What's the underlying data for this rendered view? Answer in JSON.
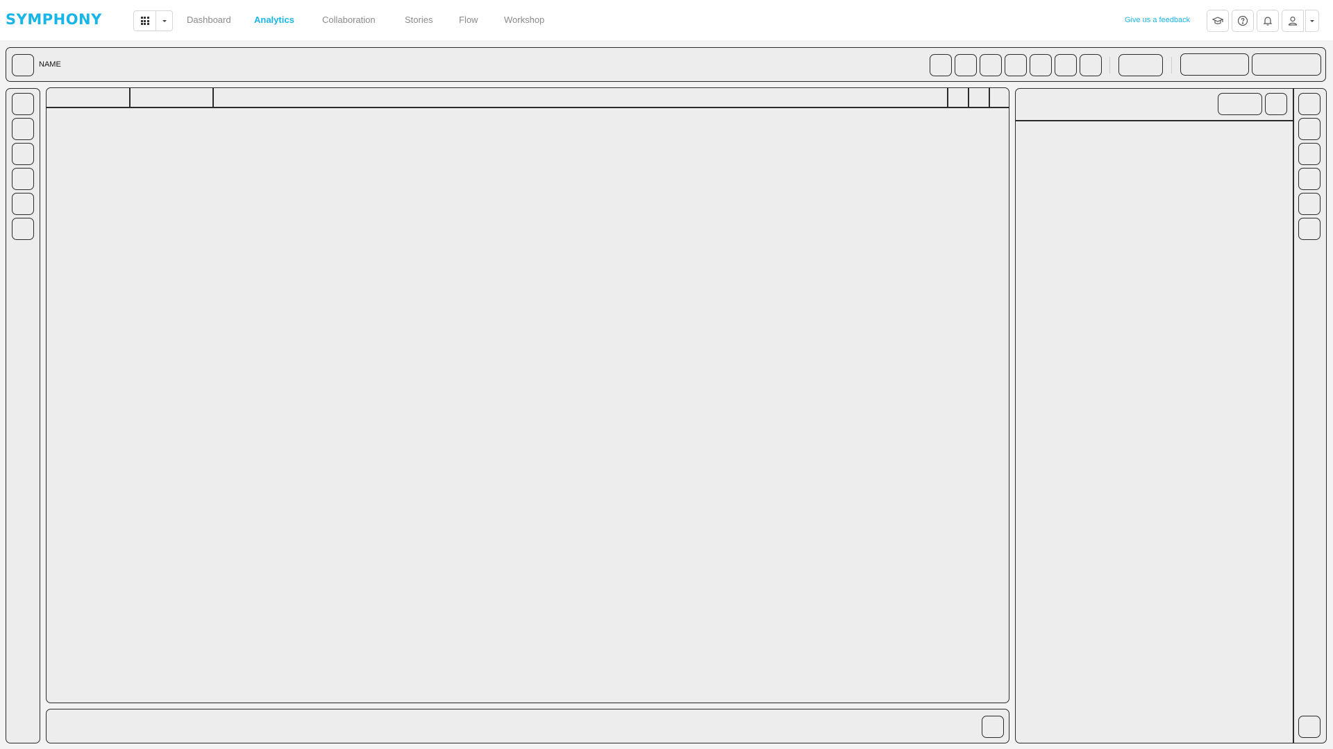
{
  "app": {
    "logo_text": "SYMPHONY",
    "accent_color": "#18b5e8"
  },
  "nav": {
    "items": [
      {
        "label": "Dashboard",
        "active": false
      },
      {
        "label": "Analytics",
        "active": true
      },
      {
        "label": "Collaboration",
        "active": false
      },
      {
        "label": "Stories",
        "active": false
      },
      {
        "label": "Flow",
        "active": false
      },
      {
        "label": "Workshop",
        "active": false
      }
    ],
    "apps_menu_icon": "apps-grid-icon"
  },
  "header_actions": {
    "feedback_label": "Give us a feedback",
    "icons": [
      "graduation-cap-icon",
      "help-circle-icon",
      "bell-icon",
      "user-icon"
    ]
  },
  "toolbar": {
    "name_label": "NAME"
  }
}
